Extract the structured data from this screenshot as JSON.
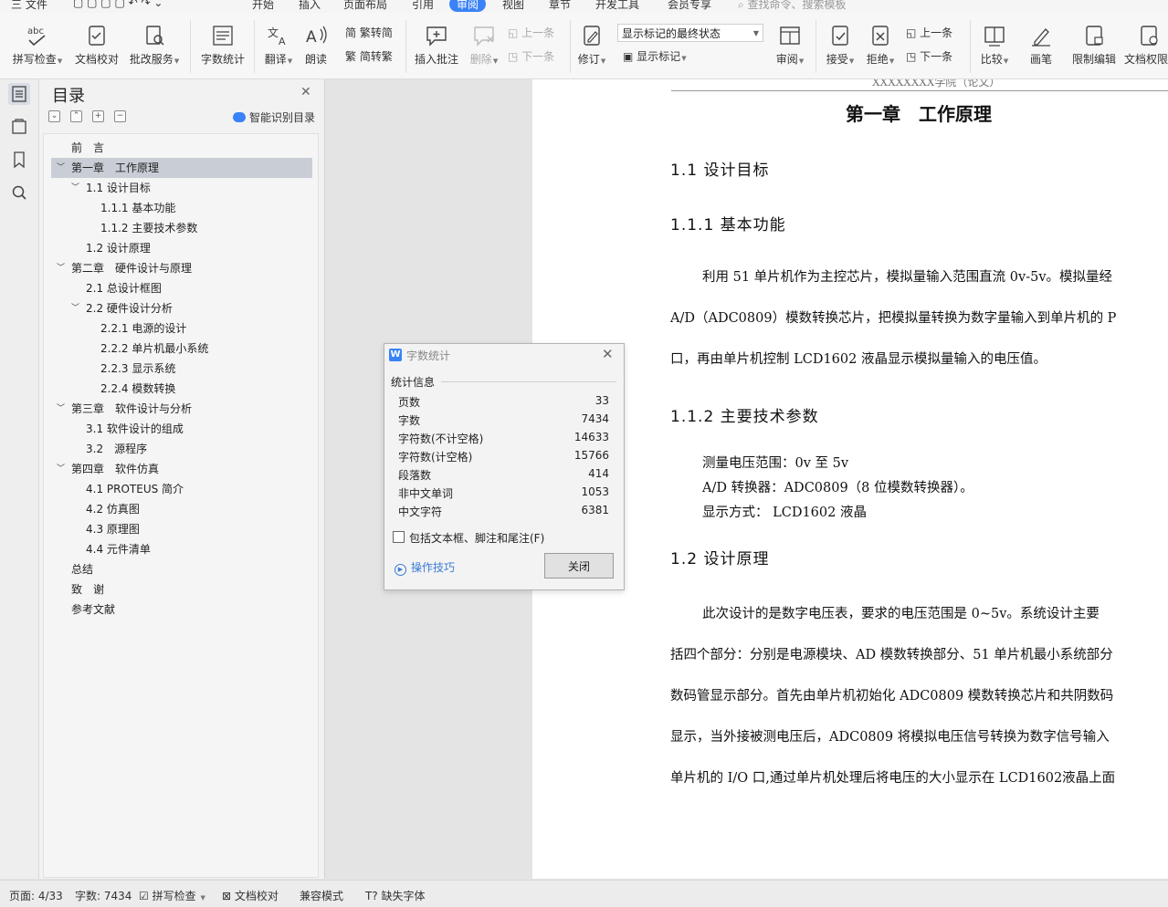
{
  "menubar": {
    "file": "三 文件",
    "tabs": [
      "开始",
      "插入",
      "页面布局",
      "引用",
      "审阅",
      "视图",
      "章节",
      "开发工具",
      "会员专享"
    ],
    "active_tab": "审阅",
    "search": "查找命令、搜索模板"
  },
  "ribbon": {
    "spell_check": "拼写检查",
    "doc_proof": "文档校对",
    "revise_service": "批改服务",
    "word_count": "字数统计",
    "translate": "翻译",
    "read_aloud": "朗读",
    "trad_to_simp": "繁转简",
    "simp_to_trad": "简转繁",
    "insert_comment": "插入批注",
    "delete": "删除",
    "prev_comment": "上一条",
    "next_comment": "下一条",
    "track_changes": "修订",
    "markup_state": "显示标记的最终状态",
    "show_markup": "显示标记",
    "reviewing_pane": "审阅",
    "accept": "接受",
    "reject": "拒绝",
    "prev_change": "上一条",
    "next_change": "下一条",
    "compare": "比较",
    "ink": "画笔",
    "restrict_editing": "限制编辑",
    "doc_permission": "文档权限"
  },
  "toc": {
    "title": "目录",
    "smart_toc": "智能识别目录",
    "items": [
      {
        "label": "前　言",
        "level": 0,
        "chevron": false
      },
      {
        "label": "第一章　工作原理",
        "level": 0,
        "chevron": true,
        "selected": true
      },
      {
        "label": "1.1 设计目标",
        "level": 1,
        "chevron": true
      },
      {
        "label": "1.1.1 基本功能",
        "level": 2,
        "chevron": false
      },
      {
        "label": "1.1.2 主要技术参数",
        "level": 2,
        "chevron": false
      },
      {
        "label": "1.2 设计原理",
        "level": 1,
        "chevron": false
      },
      {
        "label": "第二章　硬件设计与原理",
        "level": 0,
        "chevron": true
      },
      {
        "label": "2.1  总设计框图",
        "level": 1,
        "chevron": false
      },
      {
        "label": "2.2  硬件设计分析",
        "level": 1,
        "chevron": true
      },
      {
        "label": "2.2.1  电源的设计",
        "level": 2,
        "chevron": false
      },
      {
        "label": "2.2.2  单片机最小系统",
        "level": 2,
        "chevron": false
      },
      {
        "label": "2.2.3  显示系统",
        "level": 2,
        "chevron": false
      },
      {
        "label": "2.2.4  模数转换",
        "level": 2,
        "chevron": false
      },
      {
        "label": "第三章　软件设计与分析",
        "level": 0,
        "chevron": true
      },
      {
        "label": "3.1  软件设计的组成",
        "level": 1,
        "chevron": false
      },
      {
        "label": "3.2　源程序",
        "level": 1,
        "chevron": false
      },
      {
        "label": "第四章　软件仿真",
        "level": 0,
        "chevron": true
      },
      {
        "label": "4.1 PROTEUS 简介",
        "level": 1,
        "chevron": false
      },
      {
        "label": "4.2 仿真图",
        "level": 1,
        "chevron": false
      },
      {
        "label": "4.3 原理图",
        "level": 1,
        "chevron": false
      },
      {
        "label": "4.4  元件清单",
        "level": 1,
        "chevron": false
      },
      {
        "label": "总结",
        "level": 0,
        "chevron": false
      },
      {
        "label": "致　谢",
        "level": 0,
        "chevron": false
      },
      {
        "label": "参考文献",
        "level": 0,
        "chevron": false
      }
    ]
  },
  "document": {
    "header": "XXXXXXXX学院（论文）",
    "chapter_title": "第一章　工作原理",
    "s11": "1.1 设计目标",
    "s111": "1.1.1 基本功能",
    "p1": [
      "利用 51 单片机作为主控芯片，模拟量输入范围直流 0v-5v。模拟量经",
      "A/D（ADC0809）模数转换芯片，把模拟量转换为数字量输入到单片机的 P",
      "口，再由单片机控制 LCD1602 液晶显示模拟量输入的电压值。"
    ],
    "s112": "1.1.2 主要技术参数",
    "params": [
      "测量电压范围：0v 至 5v",
      "A/D 转换器：ADC0809（8 位模数转换器）。",
      "显示方式：  LCD1602 液晶"
    ],
    "s12": "1.2 设计原理",
    "p2": [
      "此次设计的是数字电压表，要求的电压范围是 0~5v。系统设计主要",
      "括四个部分：分别是电源模块、AD 模数转换部分、51 单片机最小系统部分",
      "数码管显示部分。首先由单片机初始化 ADC0809 模数转换芯片和共阴数码",
      "显示，当外接被测电压后，ADC0809 将模拟电压信号转换为数字信号输入",
      "单片机的 I/O 口,通过单片机处理后将电压的大小显示在 LCD1602液晶上面"
    ]
  },
  "dialog": {
    "title": "字数统计",
    "group": "统计信息",
    "stats": [
      {
        "label": "页数",
        "value": "33"
      },
      {
        "label": "字数",
        "value": "7434"
      },
      {
        "label": "字符数(不计空格)",
        "value": "14633"
      },
      {
        "label": "字符数(计空格)",
        "value": "15766"
      },
      {
        "label": "段落数",
        "value": "414"
      },
      {
        "label": "非中文单词",
        "value": "1053"
      },
      {
        "label": "中文字符",
        "value": "6381"
      }
    ],
    "include_label": "包括文本框、脚注和尾注(F)",
    "include_checked": false,
    "tips": "操作技巧",
    "close": "关闭"
  },
  "status": {
    "page": "页面: 4/33",
    "words": "字数: 7434",
    "spell": "拼写检查",
    "proof": "文档校对",
    "compat": "兼容模式",
    "missing_font": "缺失字体"
  },
  "colors": {
    "accent": "#3a82f7",
    "toc_selected": "#c9ced6",
    "link": "#3a7bd5"
  }
}
